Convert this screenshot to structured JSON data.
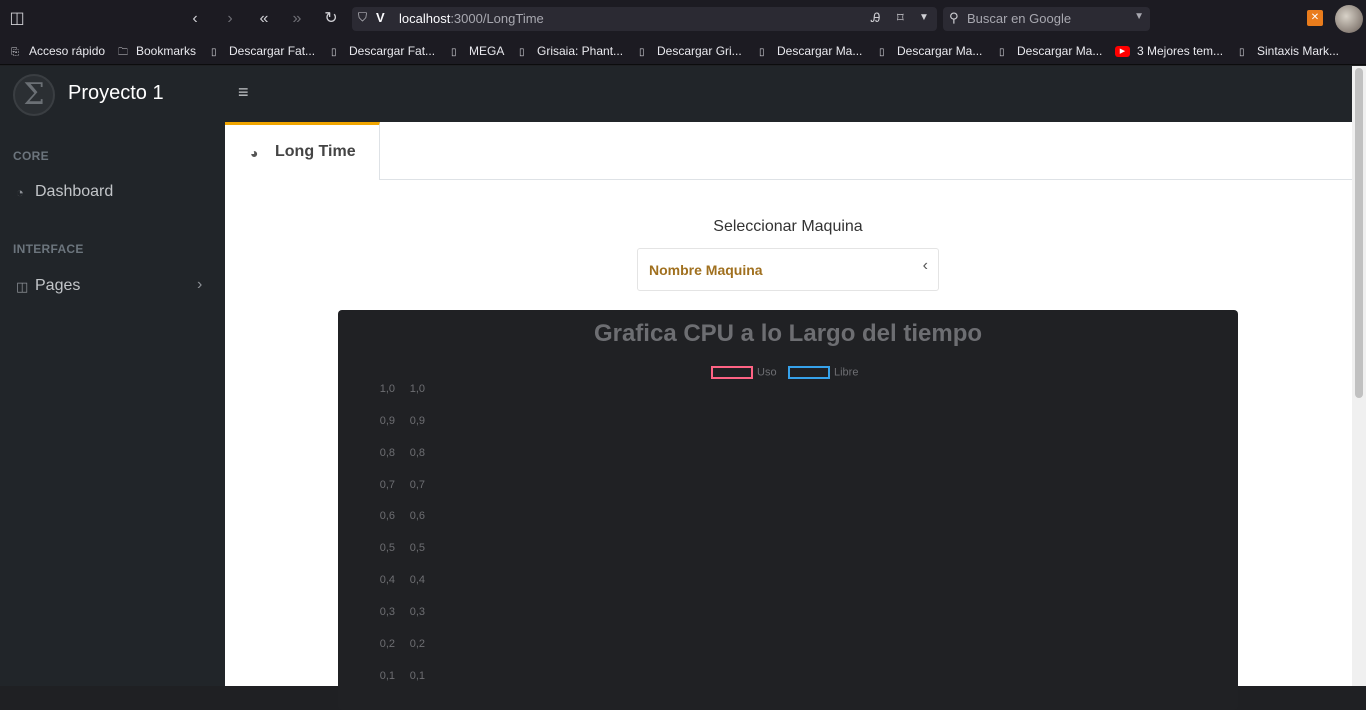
{
  "browser": {
    "url_host": "localhost",
    "url_path": ":3000/LongTime",
    "search_placeholder": "Buscar en Google",
    "bookmarks": [
      {
        "label": "Acceso rápido",
        "icon": "import-icon"
      },
      {
        "label": "Bookmarks",
        "icon": "folder-icon"
      },
      {
        "label": "Descargar Fat...",
        "icon": "page-icon"
      },
      {
        "label": "Descargar Fat...",
        "icon": "page-icon"
      },
      {
        "label": "MEGA",
        "icon": "page-icon"
      },
      {
        "label": "Grisaia: Phant...",
        "icon": "page-icon"
      },
      {
        "label": "Descargar Gri...",
        "icon": "page-icon"
      },
      {
        "label": "Descargar Ma...",
        "icon": "page-icon"
      },
      {
        "label": "Descargar Ma...",
        "icon": "page-icon"
      },
      {
        "label": "Descargar Ma...",
        "icon": "page-icon"
      },
      {
        "label": "3 Mejores tem...",
        "icon": "youtube-icon"
      },
      {
        "label": "Sintaxis Mark...",
        "icon": "page-icon"
      }
    ]
  },
  "sidebar": {
    "brand": "Proyecto 1",
    "sections": [
      {
        "heading": "CORE",
        "items": [
          {
            "label": "Dashboard",
            "icon": "dashboard-icon"
          }
        ]
      },
      {
        "heading": "INTERFACE",
        "items": [
          {
            "label": "Pages",
            "icon": "columns-icon",
            "has_chevron": true
          }
        ]
      }
    ]
  },
  "tab": {
    "label": "Long Time",
    "icon": "chrome-icon"
  },
  "selector": {
    "title": "Seleccionar Maquina",
    "value": "Nombre Maquina"
  },
  "chart_data": {
    "type": "line",
    "title": "Grafica CPU a lo Largo del tiempo",
    "series": [
      {
        "name": "Uso",
        "color": "#ff6384",
        "values": []
      },
      {
        "name": "Libre",
        "color": "#36a2eb",
        "values": []
      }
    ],
    "y_ticks_left": [
      "1,0",
      "0,9",
      "0,8",
      "0,7",
      "0,6",
      "0,5",
      "0,4",
      "0,3",
      "0,2",
      "0,1"
    ],
    "y_ticks_right": [
      "1,0",
      "0,9",
      "0,8",
      "0,7",
      "0,6",
      "0,5",
      "0,4",
      "0,3",
      "0,2",
      "0,1"
    ],
    "ylim": [
      0,
      1
    ],
    "legend_position": "top"
  }
}
